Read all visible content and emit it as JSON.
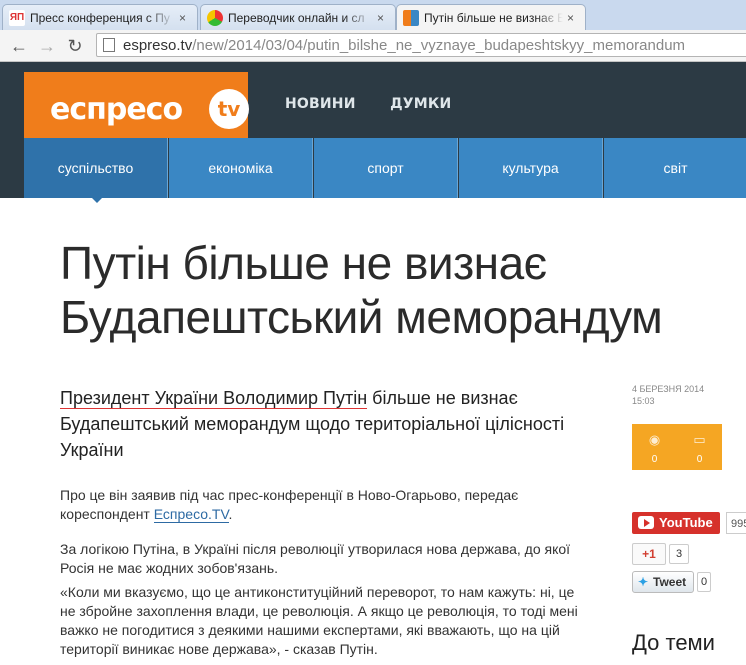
{
  "browser": {
    "tabs": [
      {
        "title": "Пресс конференция с Пу",
        "icon_label": "ЯП",
        "active": false
      },
      {
        "title": "Переводчик онлайн и сл",
        "icon_label": "",
        "active": false
      },
      {
        "title": "Путін більше не визнає Б",
        "icon_label": "",
        "active": true
      }
    ],
    "url_host": "espreso.tv",
    "url_path": "/new/2014/03/04/putin_bilshe_ne_vyznaye_budapeshtskyy_memorandum",
    "back_icon": "←",
    "forward_icon": "→",
    "reload_icon": "↻",
    "close_icon": "×"
  },
  "site": {
    "logo_text": "еспресо",
    "logo_tv": "tv",
    "main_nav": [
      "НОВИНИ",
      "ДУМКИ"
    ],
    "categories": [
      "суспільство",
      "економіка",
      "спорт",
      "культура",
      "світ"
    ],
    "active_category": 0,
    "colors": {
      "header": "#2c3a44",
      "logo": "#f07d1b",
      "category": "#3a87c4",
      "stat": "#f5a623"
    }
  },
  "article": {
    "title": "Путін більше не визнає Будапештський меморандум",
    "lead_part1": "Президент України Володимир Путін",
    "lead_part2": " більше не визнає Будапештський меморандум щодо територіальної цілісності України",
    "p1_text": "Про це він заявив під час прес-конференції в Ново-Огарьово, передає кореспондент ",
    "p1_link": "Еспресо.TV",
    "p1_end": ".",
    "p2": "За логікою Путіна, в Україні після революції утворилася нова держава, до якої Росія  не має жодних зобов'язань.",
    "p3": "«Коли ми вказуємо, що це антиконституційний переворот, то нам кажуть: ні, це не збройне захоплення влади, це революція. А якщо це революція, то тоді мені важко не погодитися з деякими нашими експертами, які вважають, що на цій території виникає нове держава», - сказав Путін."
  },
  "sidebar": {
    "date": "4 БЕРЕЗНЯ 2014",
    "time": "15:03",
    "views": "0",
    "comments": "0",
    "youtube_label": "YouTube",
    "youtube_count": "995",
    "gplus_label": "+1",
    "gplus_count": "3",
    "tweet_label": "Tweet",
    "tweet_count": "0",
    "related_heading": "До теми"
  }
}
